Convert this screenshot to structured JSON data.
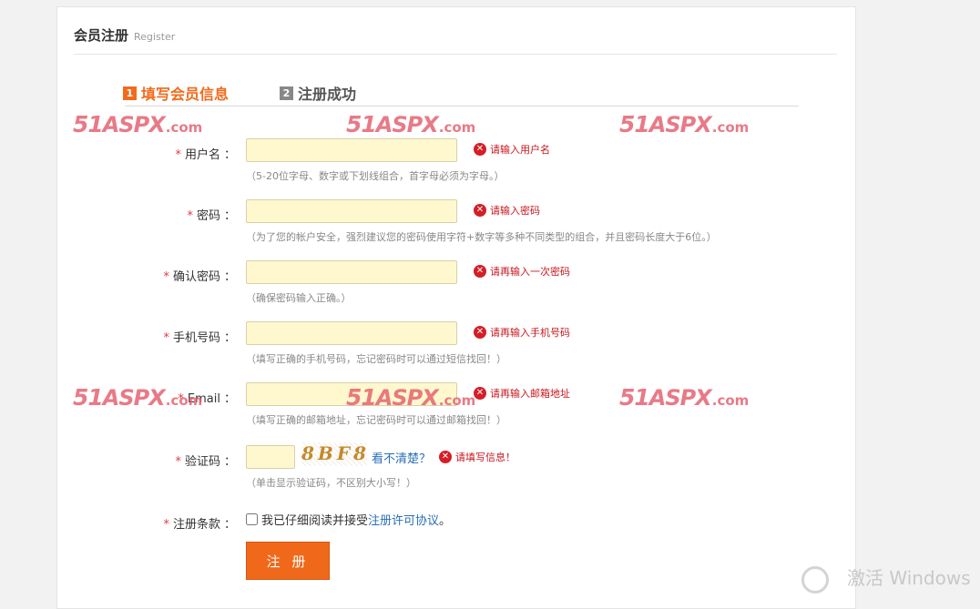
{
  "header": {
    "title": "会员注册",
    "subtitle": "Register"
  },
  "steps": [
    {
      "num": "1",
      "label": "填写会员信息",
      "active": true
    },
    {
      "num": "2",
      "label": "注册成功",
      "active": false
    }
  ],
  "watermark": {
    "brand": "51",
    "brand2": "ASPX",
    "domain": ".com"
  },
  "form": {
    "required_mark": "*",
    "colon": "：",
    "fields": [
      {
        "label": "用户名",
        "error": "请输入用户名",
        "hint": "（5-20位字母、数字或下划线组合，首字母必须为字母。）",
        "value": ""
      },
      {
        "label": "密码",
        "error": "请输入密码",
        "hint": "（为了您的帐户安全，强烈建议您的密码使用字符+数字等多种不同类型的组合，并且密码长度大于6位。）",
        "value": ""
      },
      {
        "label": "确认密码",
        "error": "请再输入一次密码",
        "hint": "（确保密码输入正确。）",
        "value": ""
      },
      {
        "label": "手机号码",
        "error": "请再输入手机号码",
        "hint": "（填写正确的手机号码，忘记密码时可以通过短信找回！）",
        "value": ""
      },
      {
        "label": "Email",
        "error": "请再输入邮箱地址",
        "hint": "（填写正确的邮箱地址，忘记密码时可以通过邮箱找回！）",
        "value": ""
      }
    ],
    "captcha": {
      "label": "验证码",
      "image_text": "8BF8",
      "refresh_link": "看不清楚？",
      "error": "请填写信息！",
      "hint": "（单击显示验证码，不区别大小写！）"
    },
    "terms": {
      "label": "注册条款",
      "text": "我已仔细阅读并接受",
      "link": "注册许可协议",
      "suffix": "。"
    },
    "submit_label": "注 册"
  },
  "error_icon_glyph": "✕",
  "os_overlay": {
    "text": "激活 Windows"
  },
  "colors": {
    "accent": "#f0691b",
    "error": "#d51e26",
    "link": "#2a6fb8",
    "field_bg": "#fff8cf"
  }
}
